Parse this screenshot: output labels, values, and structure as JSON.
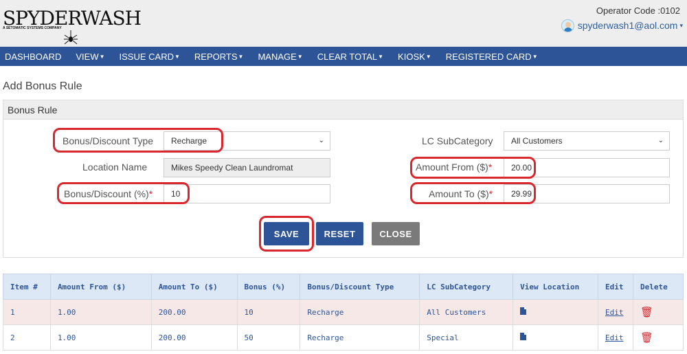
{
  "header": {
    "logo_text_1": "SPYDER",
    "logo_text_2": "WASH",
    "logo_sub": "A SETOMATIC SYSTEMS COMPANY",
    "operator_code": "Operator Code :0102",
    "user_email": "spyderwash1@aol.com"
  },
  "nav": {
    "items": [
      {
        "label": "DASHBOARD",
        "dropdown": false
      },
      {
        "label": "VIEW",
        "dropdown": true
      },
      {
        "label": "ISSUE CARD",
        "dropdown": true
      },
      {
        "label": "REPORTS",
        "dropdown": true
      },
      {
        "label": "MANAGE",
        "dropdown": true
      },
      {
        "label": "CLEAR TOTAL",
        "dropdown": true
      },
      {
        "label": "KIOSK",
        "dropdown": true
      },
      {
        "label": "REGISTERED CARD",
        "dropdown": true
      }
    ]
  },
  "page_title": "Add Bonus Rule",
  "form": {
    "panel_title": "Bonus Rule",
    "bonus_type_label": "Bonus/Discount Type",
    "bonus_type_value": "Recharge",
    "location_label": "Location Name",
    "location_value": "Mikes Speedy Clean Laundromat",
    "bonus_pct_label": "Bonus/Discount (%)",
    "bonus_pct_value": "10",
    "subcategory_label": "LC SubCategory",
    "subcategory_value": "All Customers",
    "amount_from_label": "Amount From ($)",
    "amount_from_value": "20.00",
    "amount_to_label": "Amount To ($)",
    "amount_to_value": "29.99",
    "required_mark": "*",
    "save_label": "SAVE",
    "reset_label": "RESET",
    "close_label": "CLOSE"
  },
  "table": {
    "headers": {
      "item": "Item #",
      "amount_from": "Amount From ($)",
      "amount_to": "Amount To ($)",
      "bonus": "Bonus (%)",
      "type": "Bonus/Discount Type",
      "subcategory": "LC SubCategory",
      "view_location": "View Location",
      "edit": "Edit",
      "delete": "Delete"
    },
    "rows": [
      {
        "item": "1",
        "amount_from": "1.00",
        "amount_to": "200.00",
        "bonus": "10",
        "type": "Recharge",
        "subcategory": "All Customers",
        "edit": "Edit"
      },
      {
        "item": "2",
        "amount_from": "1.00",
        "amount_to": "200.00",
        "bonus": "50",
        "type": "Recharge",
        "subcategory": "Special",
        "edit": "Edit"
      }
    ]
  },
  "colors": {
    "nav_bg": "#2d5497",
    "highlight": "#d9272e",
    "close_btn": "#7a7a7a",
    "row_odd": "#f7e8e8"
  }
}
